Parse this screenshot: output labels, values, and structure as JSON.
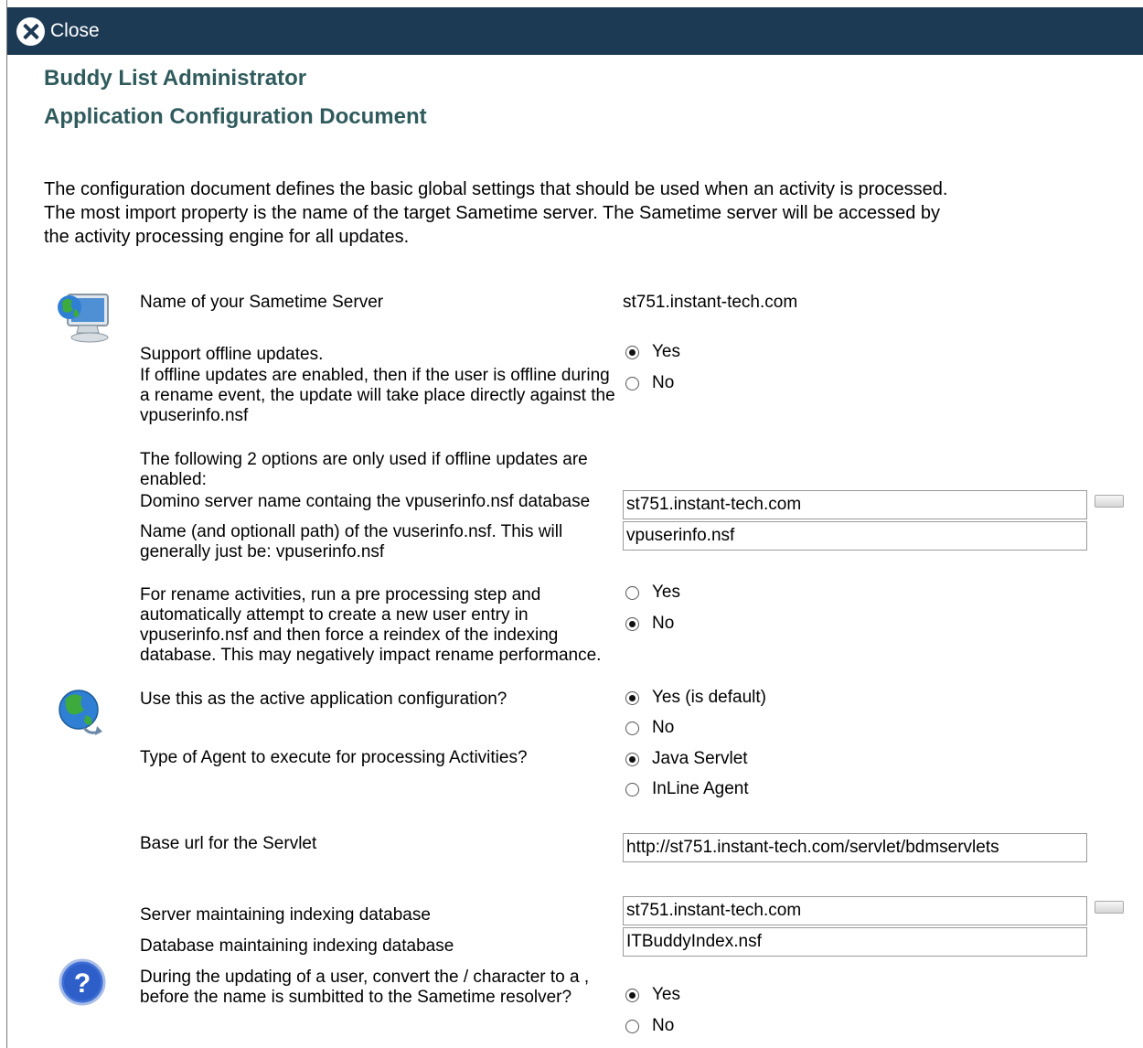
{
  "close_label": "Close",
  "header": {
    "title": "Buddy List Administrator",
    "subtitle": "Application Configuration Document"
  },
  "intro": "The configuration document defines the basic global settings that should be used when an activity is processed.  The most import property is the name of the target Sametime server.  The Sametime server will be accessed by the activity processing engine for all updates.",
  "fields": {
    "server_name": {
      "label": "Name of your Sametime Server",
      "value": "st751.instant-tech.com"
    },
    "offline": {
      "label": "Support offline updates.",
      "help": "If offline updates are enabled, then if the user is offline during a rename event, the update will take place directly against the vpuserinfo.nsf",
      "options": [
        "Yes",
        "No"
      ],
      "selected": "Yes"
    },
    "offline_note": "The following 2 options are only used if offline updates are enabled:",
    "domino_server": {
      "label": "Domino server name containg the vpuserinfo.nsf database",
      "value": "st751.instant-tech.com"
    },
    "vpuserinfo_path": {
      "label": "Name (and optionall path) of the vuserinfo.nsf.  This will generally just be: vpuserinfo.nsf",
      "value": "vpuserinfo.nsf"
    },
    "rename_pre": {
      "label": "For rename activities, run a pre processing step and automatically attempt to create a new user entry in vpuserinfo.nsf and then force a reindex of the indexing database.  This may negatively impact rename performance.",
      "options": [
        "Yes",
        "No"
      ],
      "selected": "No"
    },
    "active_config": {
      "label": "Use this as the active application configuration?",
      "options": [
        "Yes (is default)",
        "No"
      ],
      "selected": "Yes (is default)"
    },
    "agent_type": {
      "label": "Type of Agent to execute for processing Activities?",
      "options": [
        "Java Servlet",
        "InLine Agent"
      ],
      "selected": "Java Servlet"
    },
    "servlet_url": {
      "label": "Base url for the Servlet",
      "value": "http://st751.instant-tech.com/servlet/bdmservlets"
    },
    "index_server": {
      "label": "Server maintaining indexing database",
      "value": "st751.instant-tech.com"
    },
    "index_db": {
      "label": "Database maintaining indexing database",
      "value": "ITBuddyIndex.nsf"
    },
    "convert_slash": {
      "label": "During the updating of a user, convert the / character to a , before the name is sumbitted to the Sametime resolver?",
      "options": [
        "Yes",
        "No"
      ],
      "selected": "Yes"
    }
  }
}
